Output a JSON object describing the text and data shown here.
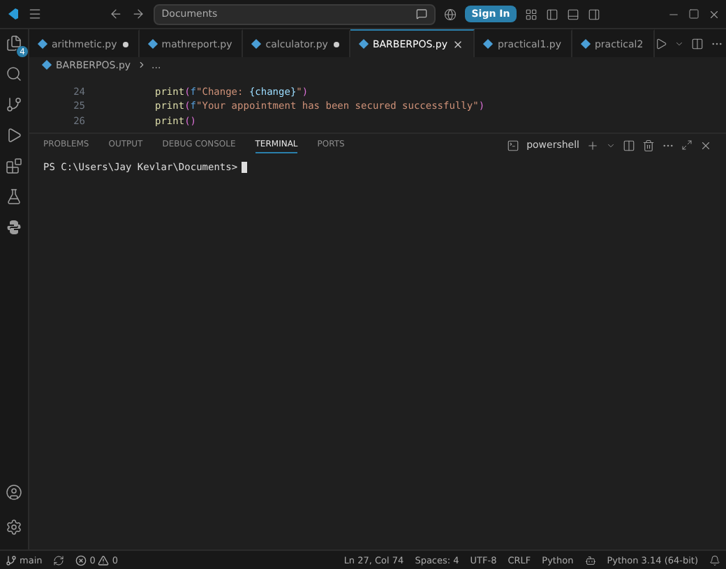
{
  "titlebar": {
    "search": "Documents",
    "sign_in": "Sign In"
  },
  "activity_bar": {
    "badge": "4"
  },
  "tabs": [
    {
      "label": "arithmetic.py",
      "selected": false,
      "modified": true
    },
    {
      "label": "mathreport.py",
      "selected": false,
      "modified": false
    },
    {
      "label": "calculator.py",
      "selected": false,
      "modified": true
    },
    {
      "label": "BARBERPOS.py",
      "selected": true,
      "modified": false
    },
    {
      "label": "practical1.py",
      "selected": false,
      "modified": false
    },
    {
      "label": "practical2",
      "selected": false,
      "modified": false
    }
  ],
  "breadcrumb": [
    "BARBERPOS.py",
    "..."
  ],
  "code_lines": [
    {
      "number": "24",
      "tokens": [
        {
          "kind": "fn",
          "text": "print"
        },
        {
          "kind": "punc",
          "text": "("
        },
        {
          "kind": "kw",
          "text": "f"
        },
        {
          "kind": "str",
          "text": "\"Change: "
        },
        {
          "kind": "var",
          "text": "{change}"
        },
        {
          "kind": "str",
          "text": "\""
        },
        {
          "kind": "punc",
          "text": ")"
        }
      ]
    },
    {
      "number": "25",
      "tokens": [
        {
          "kind": "fn",
          "text": "print"
        },
        {
          "kind": "punc",
          "text": "("
        },
        {
          "kind": "kw",
          "text": "f"
        },
        {
          "kind": "str",
          "text": "\"Your appointment has been secured successfully\""
        },
        {
          "kind": "punc",
          "text": ")"
        }
      ]
    },
    {
      "number": "26",
      "tokens": [
        {
          "kind": "fn",
          "text": "print"
        },
        {
          "kind": "punc",
          "text": "()"
        }
      ]
    }
  ],
  "panel": {
    "tabs": [
      {
        "label": "PROBLEMS",
        "selected": false
      },
      {
        "label": "OUTPUT",
        "selected": false
      },
      {
        "label": "DEBUG CONSOLE",
        "selected": false
      },
      {
        "label": "TERMINAL",
        "selected": true
      },
      {
        "label": "PORTS",
        "selected": false
      }
    ],
    "terminal_name": "powershell",
    "prompt": "PS C:\\Users\\Jay Kevlar\\Documents>"
  },
  "status_bar": {
    "branch": "main",
    "errors": "0",
    "warnings": "0",
    "items": [
      "Ln 27, Col 74",
      "Spaces: 4",
      "UTF-8",
      "CRLF",
      "Python"
    ],
    "interpreter": "Python 3.14 (64-bit)"
  }
}
